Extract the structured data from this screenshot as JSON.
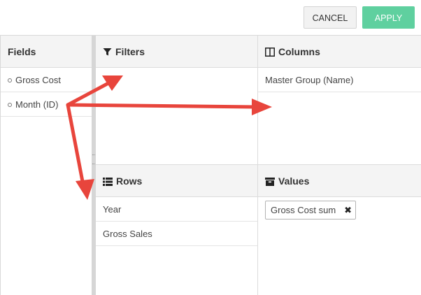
{
  "toolbar": {
    "cancel_label": "CANCEL",
    "apply_label": "APPLY"
  },
  "fields": {
    "header": "Fields",
    "items": [
      {
        "label": "Gross Cost"
      },
      {
        "label": "Month (ID)"
      }
    ]
  },
  "filters": {
    "header": "Filters",
    "icon": "filter-icon",
    "items": []
  },
  "columns": {
    "header": "Columns",
    "icon": "columns-icon",
    "items": [
      {
        "label": "Master Group (Name)"
      }
    ]
  },
  "rows": {
    "header": "Rows",
    "icon": "list-icon",
    "items": [
      {
        "label": "Year"
      },
      {
        "label": "Gross Sales"
      }
    ]
  },
  "values": {
    "header": "Values",
    "icon": "archive-icon",
    "items": [
      {
        "label": "Gross Cost sum",
        "remove_icon": "close-icon"
      }
    ]
  },
  "colors": {
    "apply_button": "#5fd09f",
    "header_background": "#f4f4f4",
    "annotation_arrow": "#e8453c"
  }
}
